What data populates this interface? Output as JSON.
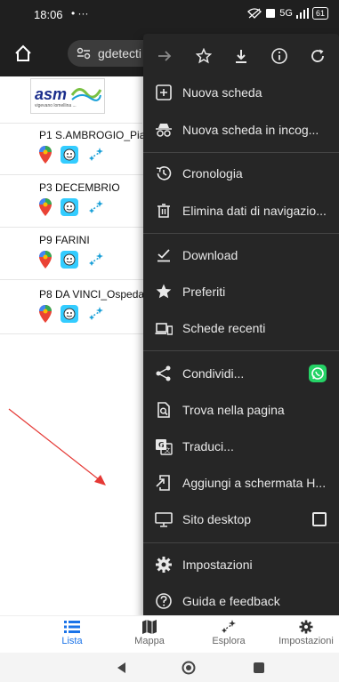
{
  "status_bar": {
    "time": "18:06",
    "left_icons": "• ···",
    "network": "5G",
    "battery": "61"
  },
  "browser": {
    "url_fragment": "gdetecti"
  },
  "logo": {
    "name": "asm",
    "subtitle": "vigevano lomellina ..."
  },
  "parkings": [
    {
      "name": "P1 S.AMBROGIO_Piaz"
    },
    {
      "name": "P3 DECEMBRIO"
    },
    {
      "name": "P9 FARINI"
    },
    {
      "name": "P8 DA VINCI_Ospeda"
    }
  ],
  "menu": {
    "items": [
      {
        "label": "Nuova scheda",
        "icon": "new-tab-icon"
      },
      {
        "label": "Nuova scheda in incog...",
        "icon": "incognito-icon"
      },
      {
        "label": "Cronologia",
        "icon": "history-icon"
      },
      {
        "label": "Elimina dati di navigazio...",
        "icon": "trash-icon"
      },
      {
        "label": "Download",
        "icon": "download-check-icon"
      },
      {
        "label": "Preferiti",
        "icon": "star-filled-icon"
      },
      {
        "label": "Schede recenti",
        "icon": "devices-icon"
      },
      {
        "label": "Condividi...",
        "icon": "share-icon"
      },
      {
        "label": "Trova nella pagina",
        "icon": "find-in-page-icon"
      },
      {
        "label": "Traduci...",
        "icon": "translate-icon"
      },
      {
        "label": "Aggiungi a schermata H...",
        "icon": "add-to-home-icon"
      },
      {
        "label": "Sito desktop",
        "icon": "desktop-icon"
      },
      {
        "label": "Impostazioni",
        "icon": "settings-gear-icon"
      },
      {
        "label": "Guida e feedback",
        "icon": "help-icon"
      }
    ]
  },
  "app_nav": {
    "items": [
      {
        "label": "Lista"
      },
      {
        "label": "Mappa"
      },
      {
        "label": "Esplora"
      },
      {
        "label": "Impostazioni"
      }
    ]
  },
  "colors": {
    "menu_bg": "#262626",
    "accent": "#1a73e8",
    "whatsapp": "#25d366",
    "annotation_arrow": "#e53935"
  }
}
